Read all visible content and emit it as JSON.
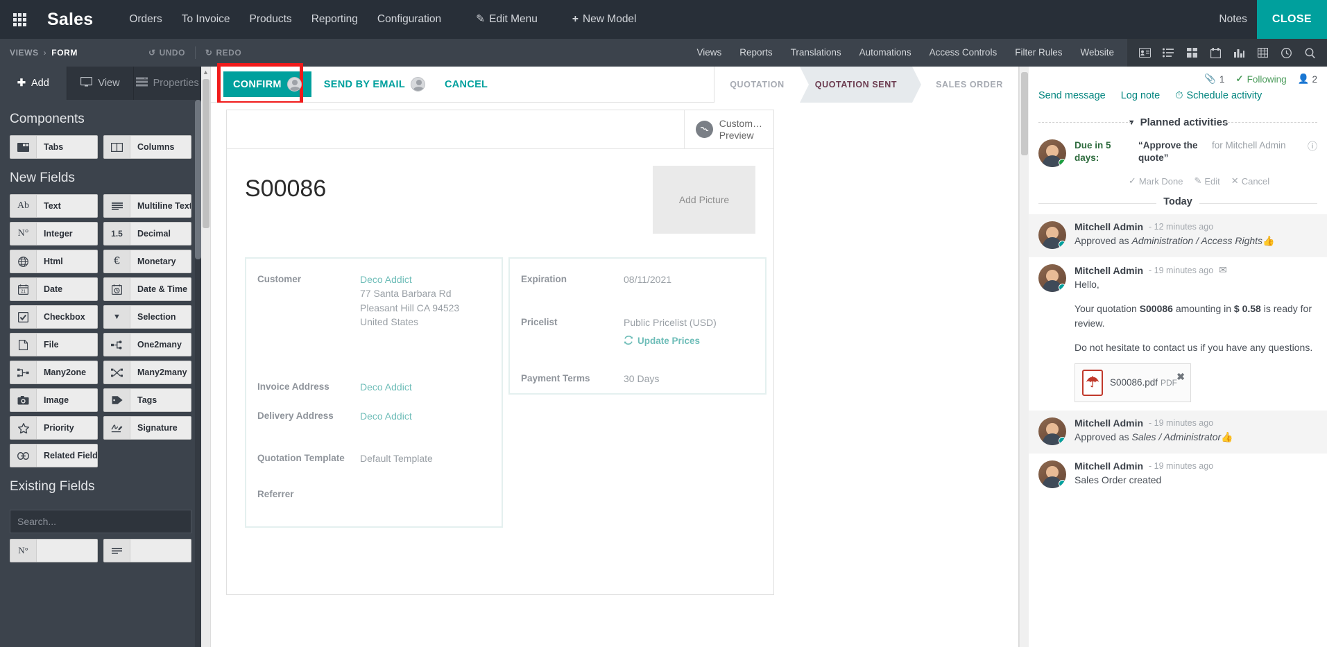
{
  "navbar": {
    "apps_icon": "apps-grid-icon",
    "brand": "Sales",
    "items": [
      {
        "label": "Orders"
      },
      {
        "label": "To Invoice"
      },
      {
        "label": "Products"
      },
      {
        "label": "Reporting"
      },
      {
        "label": "Configuration"
      }
    ],
    "edit_menu": "Edit Menu",
    "new_model": "New Model",
    "notes": "Notes",
    "close": "CLOSE",
    "accent": "#00A09D",
    "bg": "#282f38"
  },
  "studiobar": {
    "breadcrumb": {
      "root": "VIEWS",
      "sep": "›",
      "current": "FORM"
    },
    "undo": "UNDO",
    "redo": "REDO",
    "tabs": [
      {
        "label": "Views"
      },
      {
        "label": "Reports"
      },
      {
        "label": "Translations"
      },
      {
        "label": "Automations"
      },
      {
        "label": "Access Controls"
      },
      {
        "label": "Filter Rules"
      },
      {
        "label": "Website"
      }
    ],
    "view_icons": [
      {
        "name": "contact-card-icon",
        "glyph": "▤"
      },
      {
        "name": "list-view-icon",
        "glyph": "☰"
      },
      {
        "name": "kanban-view-icon",
        "glyph": "▦"
      },
      {
        "name": "calendar-view-icon",
        "glyph": "Ὄ5"
      },
      {
        "name": "graph-view-icon",
        "glyph": "ὌA"
      },
      {
        "name": "pivot-view-icon",
        "glyph": "⊞"
      },
      {
        "name": "activity-view-icon",
        "glyph": "◴"
      },
      {
        "name": "search-icon",
        "glyph": "⚲"
      }
    ]
  },
  "sidebar": {
    "tabs": [
      {
        "label": "Add",
        "icon": "plus-icon",
        "active": true
      },
      {
        "label": "View",
        "icon": "monitor-icon",
        "active": false
      },
      {
        "label": "Properties",
        "icon": "properties-icon",
        "active": false
      }
    ],
    "components_header": "Components",
    "components": [
      {
        "label": "Tabs",
        "icon": "tabs-icon"
      },
      {
        "label": "Columns",
        "icon": "columns-icon"
      }
    ],
    "new_fields_header": "New Fields",
    "new_fields": [
      {
        "label": "Text",
        "icon": "text-icon",
        "glyph": "Ab"
      },
      {
        "label": "Multiline Text",
        "icon": "multiline-text-icon",
        "glyph": "≡"
      },
      {
        "label": "Integer",
        "icon": "integer-icon",
        "glyph": "N°"
      },
      {
        "label": "Decimal",
        "icon": "decimal-icon",
        "glyph": "1.5"
      },
      {
        "label": "Html",
        "icon": "html-globe-icon",
        "glyph": "ἱ0"
      },
      {
        "label": "Monetary",
        "icon": "monetary-icon",
        "glyph": "€"
      },
      {
        "label": "Date",
        "icon": "date-icon",
        "glyph": "21"
      },
      {
        "label": "Date & Time",
        "icon": "datetime-icon",
        "glyph": "◴"
      },
      {
        "label": "Checkbox",
        "icon": "checkbox-icon",
        "glyph": "☑"
      },
      {
        "label": "Selection",
        "icon": "selection-icon",
        "glyph": "▼"
      },
      {
        "label": "File",
        "icon": "file-icon",
        "glyph": "὜E"
      },
      {
        "label": "One2many",
        "icon": "one2many-icon",
        "glyph": "≺"
      },
      {
        "label": "Many2one",
        "icon": "many2one-icon",
        "glyph": "≻"
      },
      {
        "label": "Many2many",
        "icon": "many2many-icon",
        "glyph": "⨉"
      },
      {
        "label": "Image",
        "icon": "camera-icon",
        "glyph": "὏7"
      },
      {
        "label": "Tags",
        "icon": "tag-icon",
        "glyph": "Ἷ7"
      },
      {
        "label": "Priority",
        "icon": "star-icon",
        "glyph": "☆"
      },
      {
        "label": "Signature",
        "icon": "signature-icon",
        "glyph": "✍"
      },
      {
        "label": "Related Field",
        "icon": "link-icon",
        "glyph": "ὑ7"
      }
    ],
    "existing_fields_header": "Existing Fields",
    "search_placeholder": "Search..."
  },
  "form": {
    "buttons": {
      "confirm": "CONFIRM",
      "send_by_email": "SEND BY EMAIL",
      "cancel": "CANCEL"
    },
    "highlight_target": "confirm",
    "highlight_color": "#f01b1b",
    "stages": [
      {
        "label": "QUOTATION",
        "state": "past"
      },
      {
        "label": "QUOTATION SENT",
        "state": "current"
      },
      {
        "label": "SALES ORDER",
        "state": "future"
      }
    ],
    "preview_button": {
      "line1": "Custom…",
      "line2": "Preview",
      "icon": "globe-icon"
    },
    "record_title": "S00086",
    "add_picture": "Add Picture",
    "left_group": [
      {
        "label": "Customer",
        "value": "Deco Addict",
        "is_link": true,
        "sublines": [
          "77 Santa Barbara Rd",
          "Pleasant Hill CA 94523",
          "United States"
        ]
      },
      {
        "label": "Invoice Address",
        "value": "Deco Addict",
        "is_link": true,
        "sublines": []
      },
      {
        "label": "Delivery Address",
        "value": "Deco Addict",
        "is_link": true,
        "sublines": []
      },
      {
        "label": "Quotation Template",
        "value": "Default Template",
        "is_link": false,
        "sublines": []
      },
      {
        "label": "Referrer",
        "value": "",
        "is_link": false,
        "sublines": []
      }
    ],
    "right_group": [
      {
        "label": "Expiration",
        "value": "08/11/2021"
      },
      {
        "label": "Pricelist",
        "value": "Public Pricelist (USD)",
        "action": "Update Prices",
        "action_icon": "refresh-icon"
      },
      {
        "label": "Payment Terms",
        "value": "30 Days"
      }
    ]
  },
  "chatter": {
    "attachment_count": "1",
    "following_label": "Following",
    "follower_count": "2",
    "actions": [
      {
        "label": "Send message",
        "icon": "message-icon"
      },
      {
        "label": "Log note",
        "icon": "note-icon"
      },
      {
        "label": "Schedule activity",
        "icon": "clock-icon"
      }
    ],
    "planned_activities_header": "Planned activities",
    "activity": {
      "due": "Due in 5 days:",
      "summary": "“Approve the quote”",
      "assignee": "for Mitchell Admin",
      "links": [
        {
          "label": "Mark Done",
          "icon": "check-icon"
        },
        {
          "label": "Edit",
          "icon": "pencil-icon"
        },
        {
          "label": "Cancel",
          "icon": "times-icon"
        }
      ]
    },
    "today_separator": "Today",
    "messages": [
      {
        "author": "Mitchell Admin",
        "time": "- 12 minutes ago",
        "alt": true,
        "icon": "",
        "lines": [
          {
            "text": "Approved as ",
            "italic_text": "Administration / Access Rights",
            "suffix": " 👍"
          }
        ]
      },
      {
        "author": "Mitchell Admin",
        "time": "- 19 minutes ago",
        "alt": false,
        "icon": "envelope-icon",
        "lines": [
          {
            "text": "Hello,"
          },
          {
            "text": "Your quotation ",
            "bold_text": "S00086",
            "suffix": " amounting in ",
            "bold_text2": "$ 0.58",
            "suffix2": " is ready for review."
          },
          {
            "text": "Do not hesitate to contact us if you have any questions."
          }
        ],
        "attachment": {
          "name": "S00086.pdf",
          "type": "PDF",
          "icon": "pdf-icon"
        }
      },
      {
        "author": "Mitchell Admin",
        "time": "- 19 minutes ago",
        "alt": true,
        "icon": "",
        "lines": [
          {
            "text": "Approved as ",
            "italic_text": "Sales / Administrator",
            "suffix": " 👍"
          }
        ]
      },
      {
        "author": "Mitchell Admin",
        "time": "- 19 minutes ago",
        "alt": false,
        "icon": "",
        "lines": [
          {
            "text": "Sales Order created"
          }
        ]
      }
    ]
  }
}
